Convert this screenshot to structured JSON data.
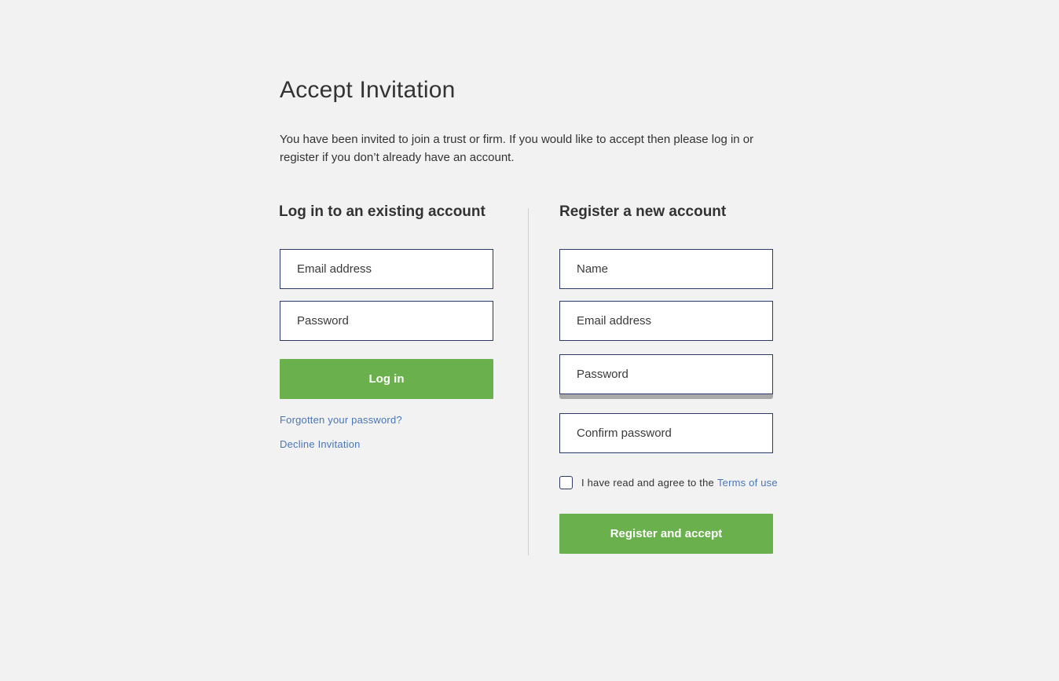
{
  "page": {
    "title": "Accept Invitation",
    "intro": "You have been invited to join a trust or firm. If you would like to accept then please log in or register if you don’t already have an account."
  },
  "login": {
    "heading": "Log in to an existing account",
    "email_placeholder": "Email address",
    "password_placeholder": "Password",
    "submit_label": "Log in",
    "forgot_link": "Forgotten your password?",
    "decline_link": "Decline Invitation"
  },
  "register": {
    "heading": "Register a new account",
    "name_placeholder": "Name",
    "email_placeholder": "Email address",
    "password_placeholder": "Password",
    "confirm_placeholder": "Confirm password",
    "terms_text": "I have read and agree to the",
    "terms_link": "Terms of use",
    "terms_checked": false,
    "submit_label": "Register and accept"
  },
  "colors": {
    "background": "#f2f2f2",
    "button": "#6ab04c",
    "link": "#4a76b8",
    "field_border": "#2b3a67"
  }
}
